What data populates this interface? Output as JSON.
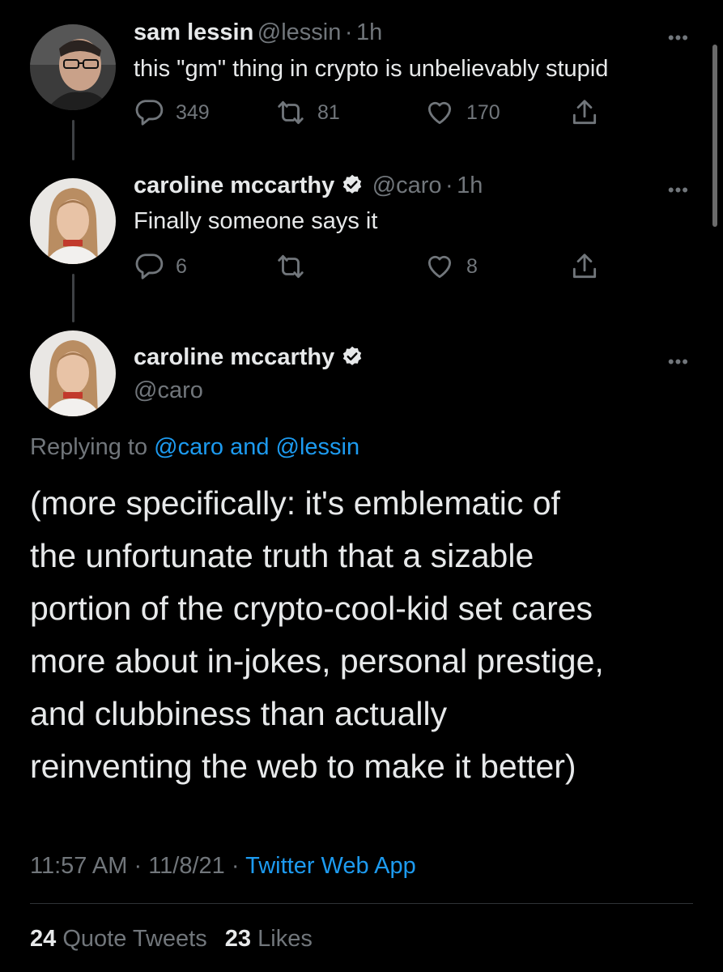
{
  "tweet1": {
    "name": "sam lessin",
    "handle": "@lessin",
    "sep": "·",
    "time": "1h",
    "text": "this \"gm\" thing in crypto is unbelievably stupid",
    "replies": "349",
    "retweets": "81",
    "likes": "170",
    "more": "•••"
  },
  "tweet2": {
    "name": "caroline mccarthy",
    "handle": "@caro",
    "sep": "·",
    "time": "1h",
    "text": "Finally someone says it",
    "replies": "6",
    "retweets": "",
    "likes": "8",
    "more": "•••"
  },
  "main": {
    "name": "caroline mccarthy",
    "handle": "@caro",
    "more": "•••",
    "replying_prefix": "Replying to",
    "replying_to": "@caro and @lessin",
    "text_lines": [
      "(more specifically: it's emblematic of",
      "the unfortunate truth that a sizable",
      "portion of the crypto-cool-kid set cares",
      "more about in-jokes, personal prestige,",
      "and clubbiness than actually",
      "reinventing the web to make it better)"
    ],
    "time": "11:57 AM",
    "date": "11/8/21",
    "sep": "·",
    "source": "Twitter Web App",
    "quote_count": "24",
    "quote_label": "Quote Tweets",
    "like_count": "23",
    "like_label": "Likes"
  },
  "colors": {
    "background": "#000000",
    "text": "#e7e9ea",
    "muted": "#71767b",
    "link": "#1d9bf0",
    "verified": "#e7e9ea"
  }
}
